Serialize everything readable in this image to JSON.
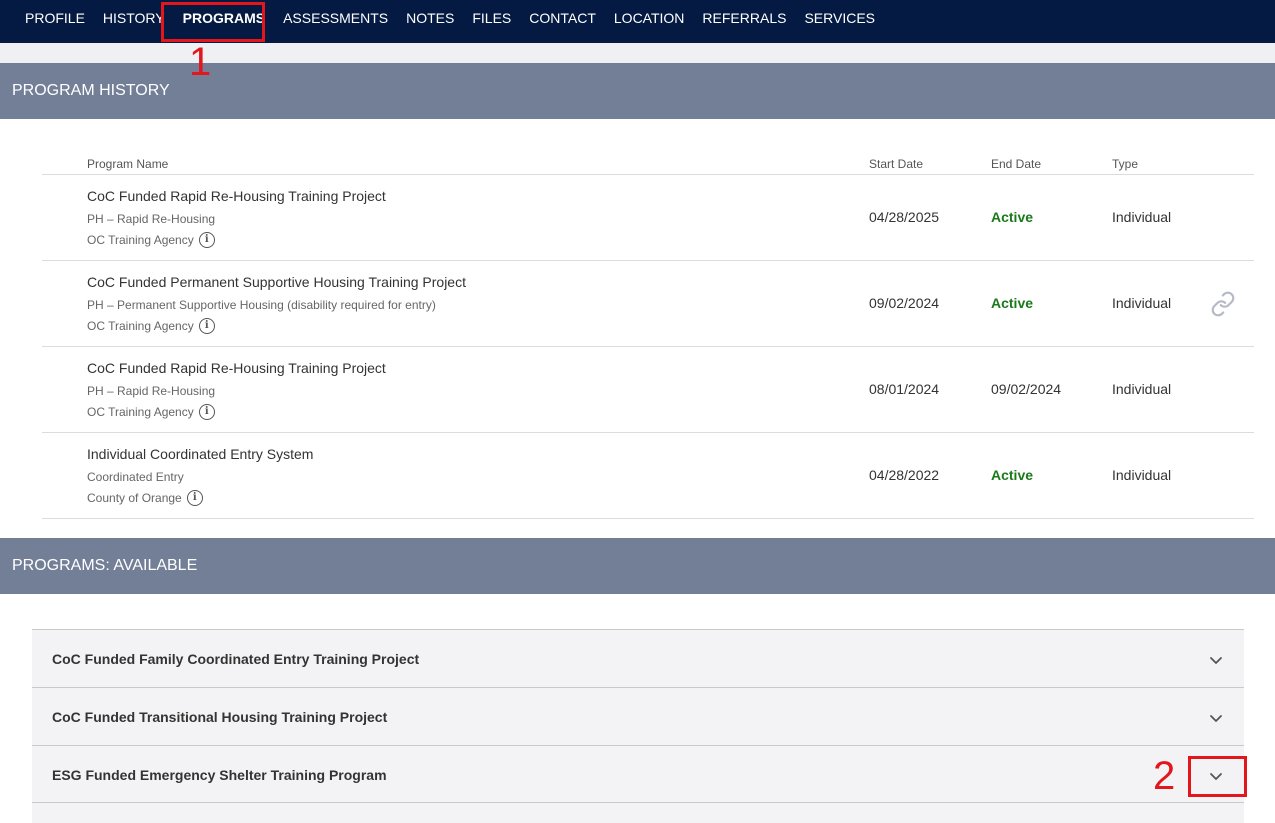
{
  "nav": {
    "items": [
      "PROFILE",
      "HISTORY",
      "PROGRAMS",
      "ASSESSMENTS",
      "NOTES",
      "FILES",
      "CONTACT",
      "LOCATION",
      "REFERRALS",
      "SERVICES"
    ],
    "active": "PROGRAMS"
  },
  "history": {
    "title": "PROGRAM HISTORY",
    "headers": {
      "name": "Program Name",
      "start": "Start Date",
      "end": "End Date",
      "type": "Type"
    },
    "rows": [
      {
        "name": "CoC Funded Rapid Re-Housing Training Project",
        "program_type": "PH – Rapid Re-Housing",
        "agency": "OC Training Agency",
        "start": "04/28/2025",
        "end": "Active",
        "type": "Individual"
      },
      {
        "name": "CoC Funded Permanent Supportive Housing Training Project",
        "program_type": "PH – Permanent Supportive Housing (disability required for entry)",
        "agency": "OC Training Agency",
        "start": "09/02/2024",
        "end": "Active",
        "type": "Individual"
      },
      {
        "name": "CoC Funded Rapid Re-Housing Training Project",
        "program_type": "PH – Rapid Re-Housing",
        "agency": "OC Training Agency",
        "start": "08/01/2024",
        "end": "09/02/2024",
        "type": "Individual"
      },
      {
        "name": "Individual Coordinated Entry System",
        "program_type": "Coordinated Entry",
        "agency": "County of Orange",
        "start": "04/28/2022",
        "end": "Active",
        "type": "Individual"
      }
    ]
  },
  "available": {
    "title": "PROGRAMS: AVAILABLE",
    "items": [
      "CoC Funded Family Coordinated Entry Training Project",
      "CoC Funded Transitional Housing Training Project",
      "ESG Funded Emergency Shelter Training Program"
    ]
  },
  "annotations": {
    "one": "1",
    "two": "2"
  },
  "icons": {
    "info": "info-icon",
    "link": "link-icon",
    "chevron": "chevron-down-icon"
  },
  "colors": {
    "nav_bg": "#051a42",
    "section_bg": "#727f97",
    "active_text": "#1a7a1a",
    "annotation": "#e3161c"
  }
}
